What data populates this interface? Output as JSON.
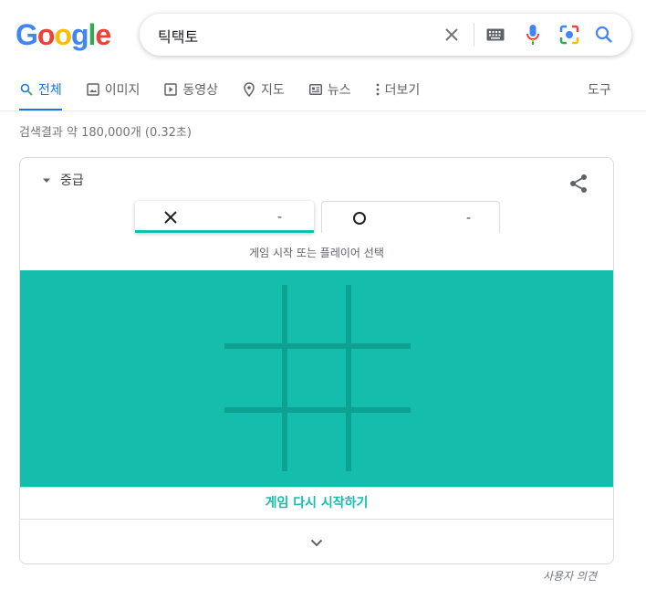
{
  "colors": {
    "accent": "#1a73e8",
    "board": "#14bdac",
    "grid_lines": "#0da192",
    "text_muted": "#70757a"
  },
  "logo": {
    "letters": [
      "G",
      "o",
      "o",
      "g",
      "l",
      "e"
    ]
  },
  "search": {
    "query": "틱택토",
    "icons": [
      "clear-icon",
      "keyboard-icon",
      "mic-icon",
      "camera-lens-icon",
      "search-icon"
    ]
  },
  "tabs": [
    {
      "label": "전체",
      "icon": "search-icon",
      "active": true
    },
    {
      "label": "이미지",
      "icon": "image-icon"
    },
    {
      "label": "동영상",
      "icon": "play-icon"
    },
    {
      "label": "지도",
      "icon": "map-pin-icon"
    },
    {
      "label": "뉴스",
      "icon": "news-icon"
    },
    {
      "label": "더보기",
      "icon": "more-vert-icon"
    }
  ],
  "tools_label": "도구",
  "stats": "검색결과 약 180,000개 (0.32초)",
  "game": {
    "difficulty": "중급",
    "players": [
      {
        "mark": "X",
        "score": "-"
      },
      {
        "mark": "O",
        "score": "-"
      }
    ],
    "prompt": "게임 시작 또는 플레이어 선택",
    "restart_label": "게임 다시 시작하기"
  },
  "feedback_label": "사용자 의견"
}
